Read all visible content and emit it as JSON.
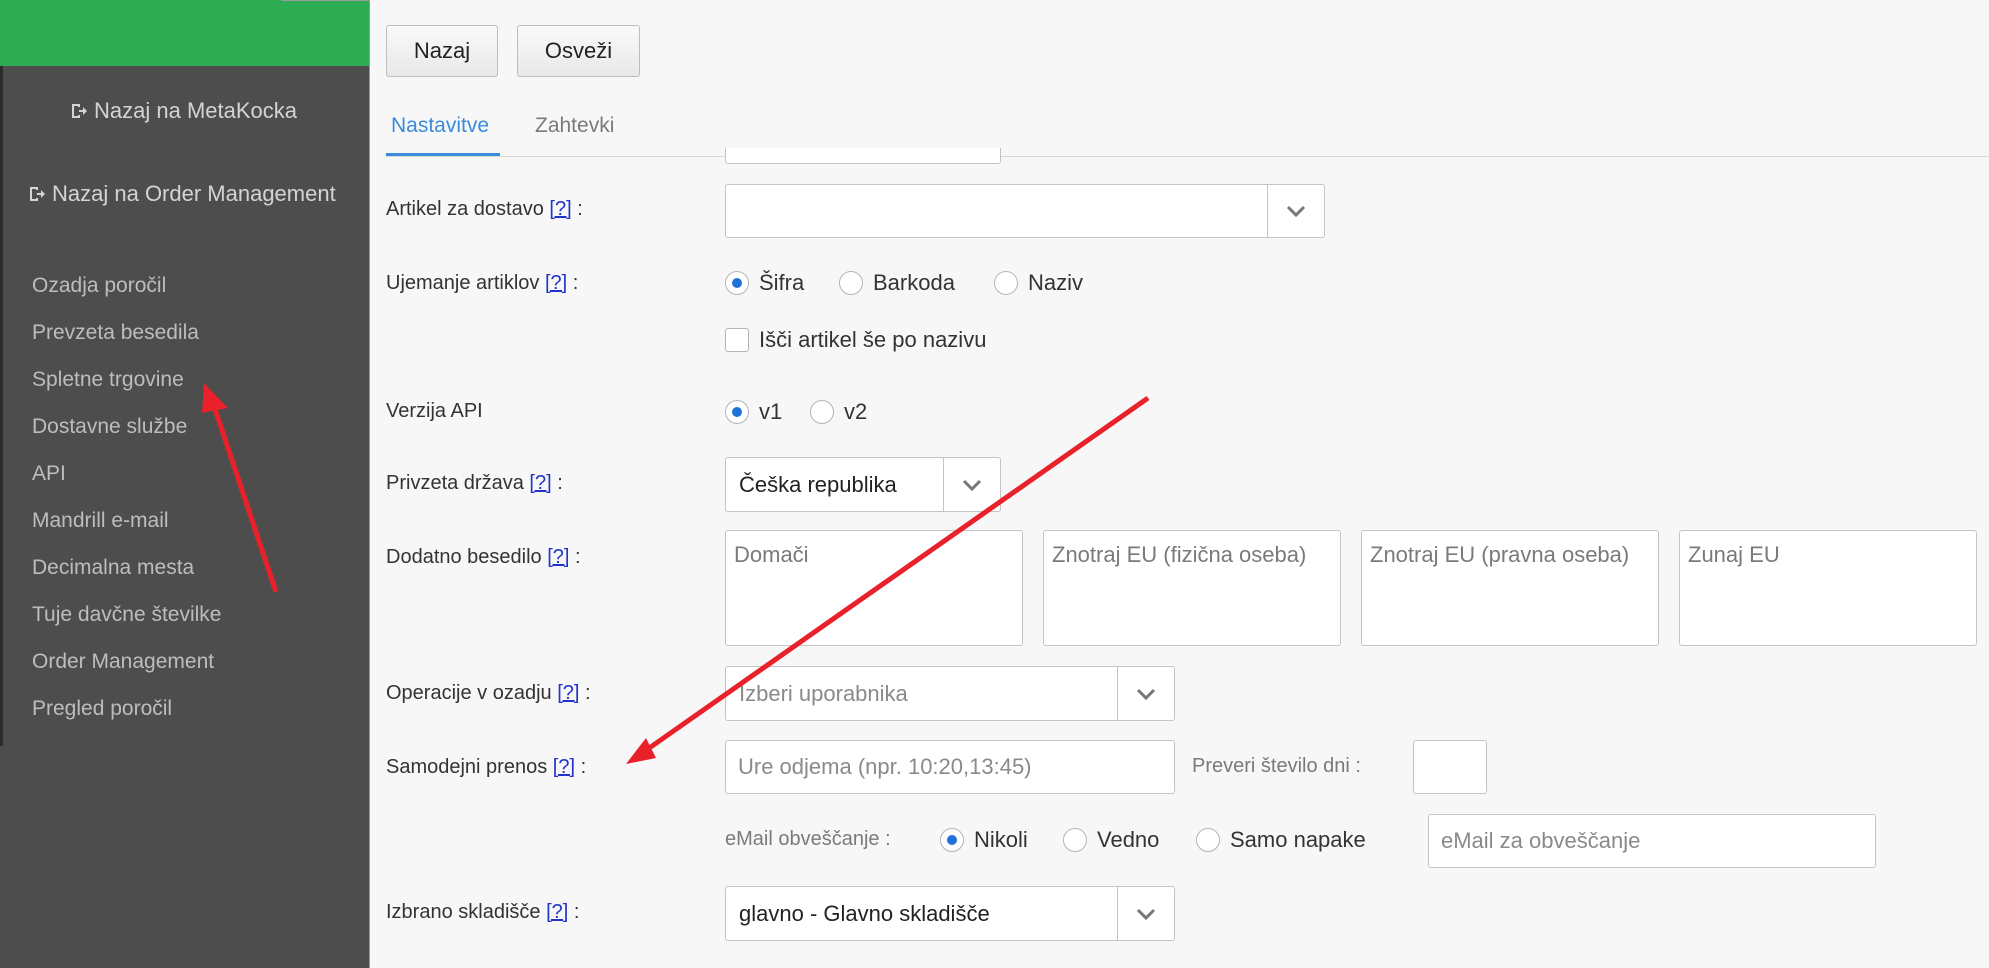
{
  "sidebar": {
    "links": [
      {
        "label": "Nazaj na MetaKocka",
        "icon": "sign-out-icon"
      },
      {
        "label": "Nazaj na Order Management",
        "icon": "sign-out-icon"
      }
    ],
    "menu": [
      "Ozadja poročil",
      "Prevzeta besedila",
      "Spletne trgovine",
      "Dostavne službe",
      "API",
      "Mandrill e-mail",
      "Decimalna mesta",
      "Tuje davčne številke",
      "Order Management",
      "Pregled poročil"
    ]
  },
  "toolbar": {
    "back_label": "Nazaj",
    "refresh_label": "Osveži"
  },
  "tabs": [
    {
      "label": "Nastavitve"
    },
    {
      "label": "Zahtevki"
    }
  ],
  "help": "[?]",
  "form": {
    "delivery_item": {
      "label": "Artikel za dostavo",
      "value": ""
    },
    "item_matching": {
      "label": "Ujemanje artiklov",
      "options": [
        "Šifra",
        "Barkoda",
        "Naziv"
      ],
      "selected": "Šifra",
      "checkbox_label": "Išči artikel še po nazivu"
    },
    "api_version": {
      "label": "Verzija API",
      "options": [
        "v1",
        "v2"
      ],
      "selected": "v1"
    },
    "default_country": {
      "label": "Privzeta država",
      "value": "Češka republika"
    },
    "extra_text": {
      "label": "Dodatno besedilo",
      "fields": [
        "Domači",
        "Znotraj EU (fizična oseba)",
        "Znotraj EU (pravna oseba)",
        "Zunaj EU"
      ]
    },
    "background_ops": {
      "label": "Operacije v ozadju",
      "placeholder": "Izberi uporabnika"
    },
    "auto_transfer": {
      "label": "Samodejni prenos",
      "placeholder": "Ure odjema (npr. 10:20,13:45)",
      "days_label": "Preveri število dni :",
      "days_value": ""
    },
    "email_notify": {
      "label": "eMail obveščanje :",
      "options": [
        "Nikoli",
        "Vedno",
        "Samo napake"
      ],
      "selected": "Nikoli",
      "placeholder": "eMail za obveščanje"
    },
    "warehouse": {
      "label": "Izbrano skladišče",
      "value": "glavno - Glavno skladišče"
    }
  },
  "colors": {
    "accent": "#3b8bd8",
    "sidebar_top": "#2eac53",
    "annotation": "#e8212b"
  }
}
